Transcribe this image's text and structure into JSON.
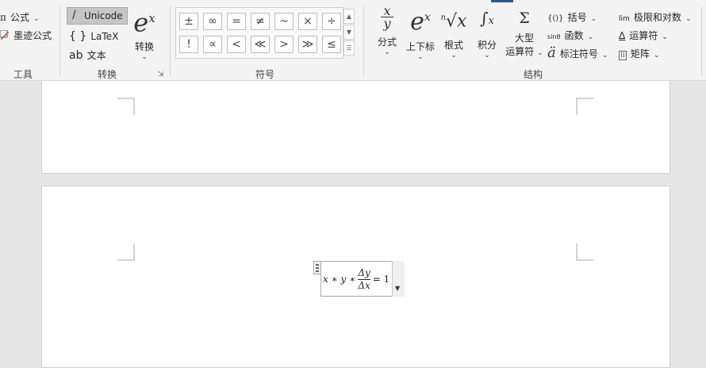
{
  "ribbon": {
    "tools": {
      "equation_label": "公式",
      "ink_equation_label": "墨迹公式",
      "group_label": "工具"
    },
    "conversions": {
      "unicode_label": "Unicode",
      "latex_label": "LaTeX",
      "text_label": "文本",
      "convert_label": "转换",
      "group_label": "转换"
    },
    "symbols": {
      "row1": [
        "±",
        "∞",
        "=",
        "≠",
        "~",
        "×",
        "÷"
      ],
      "row2": [
        "!",
        "∝",
        "<",
        "≪",
        ">",
        "≫",
        "≤"
      ],
      "group_label": "符号"
    },
    "structures": {
      "fraction_label": "分式",
      "script_label": "上下标",
      "radical_label": "根式",
      "integral_label": "积分",
      "large_operator_label_1": "大型",
      "large_operator_label_2": "运算符",
      "bracket_label": "括号",
      "function_label": "函数",
      "accent_label": "标注符号",
      "limit_log_label": "极限和对数",
      "operator_label": "运算符",
      "matrix_label": "矩阵",
      "function_prefix": "sinθ",
      "limit_prefix": "lim",
      "group_label": "结构"
    }
  },
  "document": {
    "equation": {
      "lhs": "x ∗ y ∗",
      "numerator": "Δy",
      "denominator": "Δx",
      "rhs": "= 1"
    }
  },
  "colors": {
    "accent": "#2b579a",
    "ribbon_bg": "#f3f3f3",
    "canvas_bg": "#e6e6e6"
  },
  "icons": [
    "cursor-icon",
    "braces-icon",
    "exponent-icon",
    "fraction-icon",
    "radical-icon",
    "integral-icon",
    "sum-icon",
    "bracket-icon",
    "accent-icon",
    "matrix-icon",
    "dialog-launcher-icon",
    "scroll-up-icon",
    "scroll-down-icon",
    "more-icon"
  ]
}
